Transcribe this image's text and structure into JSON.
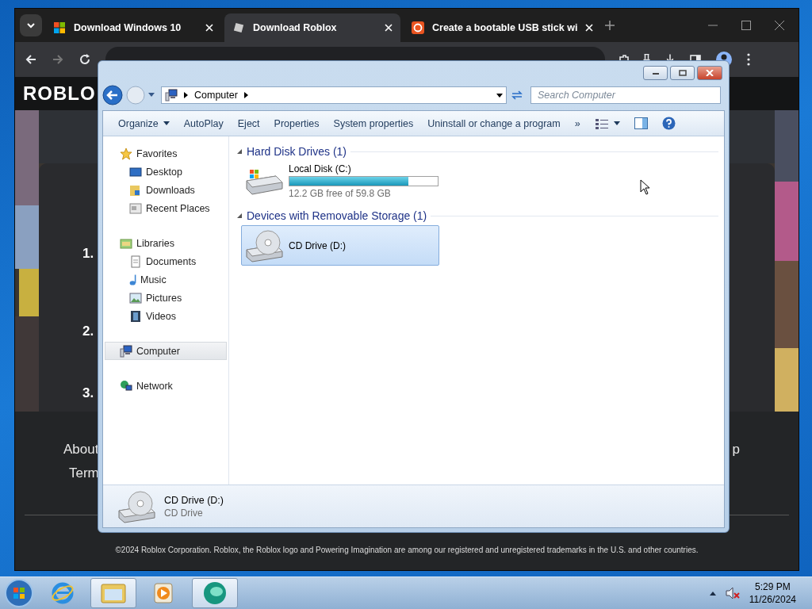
{
  "browser": {
    "tabs": [
      {
        "title": "Download Windows 10",
        "selected": false
      },
      {
        "title": "Download Roblox",
        "selected": true
      },
      {
        "title": "Create a bootable USB stick wi",
        "selected": false
      }
    ],
    "page": {
      "logo": "ROBLO",
      "steps": [
        "1.",
        "2.",
        "3."
      ],
      "links": [
        "About",
        "Term"
      ],
      "right_link": "p",
      "copyright": "©2024 Roblox Corporation. Roblox, the Roblox logo and Powering Imagination are among our registered and unregistered trademarks in the U.S. and other countries."
    }
  },
  "explorer": {
    "breadcrumb": "Computer",
    "search": {
      "placeholder": "Search Computer"
    },
    "commands": [
      {
        "label": "Organize",
        "menu": true
      },
      {
        "label": "AutoPlay",
        "menu": false
      },
      {
        "label": "Eject",
        "menu": false
      },
      {
        "label": "Properties",
        "menu": false
      },
      {
        "label": "System properties",
        "menu": false
      },
      {
        "label": "Uninstall or change a program",
        "menu": false
      },
      {
        "label": "»",
        "menu": false
      }
    ],
    "nav": [
      {
        "label": "Favorites",
        "selected": false,
        "children": [
          {
            "label": "Desktop",
            "selected": false
          },
          {
            "label": "Downloads",
            "selected": false
          },
          {
            "label": "Recent Places",
            "selected": false
          }
        ]
      },
      {
        "label": "Libraries",
        "selected": false,
        "children": [
          {
            "label": "Documents",
            "selected": false
          },
          {
            "label": "Music",
            "selected": false
          },
          {
            "label": "Pictures",
            "selected": false
          },
          {
            "label": "Videos",
            "selected": false
          }
        ]
      },
      {
        "label": "Computer",
        "selected": true
      },
      {
        "label": "Network",
        "selected": false
      }
    ],
    "sections": [
      {
        "title": "Hard Disk Drives (1)",
        "expanded": true,
        "items": [
          {
            "kind": "disk",
            "name": "Local Disk (C:)",
            "level": 0.8,
            "free": "12.2 GB free of 59.8 GB",
            "selected": false
          }
        ]
      },
      {
        "title": "Devices with Removable Storage (1)",
        "expanded": true,
        "items": [
          {
            "kind": "cd",
            "name": "CD Drive (D:)",
            "selected": true
          }
        ]
      }
    ],
    "details": {
      "name": "CD Drive (D:)",
      "type": "CD Drive"
    }
  },
  "taskbar": {
    "apps": [
      {
        "kind": "ie",
        "active": false
      },
      {
        "kind": "folder",
        "active": true
      },
      {
        "kind": "media",
        "active": false
      },
      {
        "kind": "app",
        "active": true
      }
    ],
    "clock": {
      "time": "5:29 PM",
      "date": "11/26/2024"
    }
  }
}
